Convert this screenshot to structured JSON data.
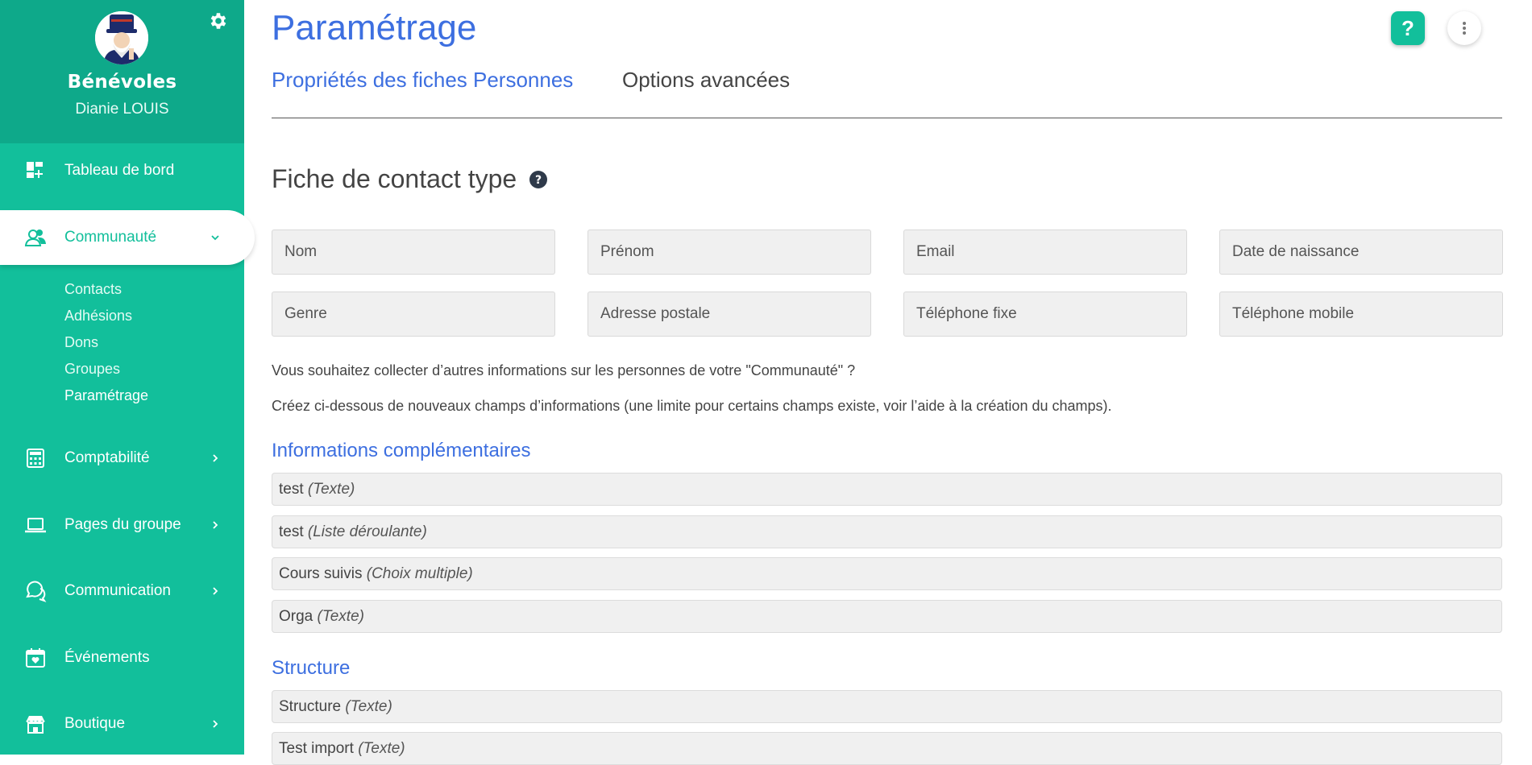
{
  "profile": {
    "name": "Bénévoles",
    "user": "Dianie LOUIS"
  },
  "nav": {
    "dashboard": "Tableau de bord",
    "community": "Communauté",
    "community_sub": [
      "Contacts",
      "Adhésions",
      "Dons",
      "Groupes",
      "Paramétrage"
    ],
    "accounting": "Comptabilité",
    "pages": "Pages du groupe",
    "communication": "Communication",
    "events": "Événements",
    "shop": "Boutique"
  },
  "header": {
    "title": "Paramétrage",
    "help_label": "?"
  },
  "tabs": [
    "Propriétés des fiches Personnes",
    "Options avancées"
  ],
  "contact_card": {
    "title": "Fiche de contact type",
    "fields": [
      "Nom",
      "Prénom",
      "Email",
      "Date de naissance",
      "Genre",
      "Adresse postale",
      "Téléphone fixe",
      "Téléphone mobile"
    ]
  },
  "intro": {
    "line1": "Vous souhaitez collecter d’autres informations sur les personnes de votre \"Communauté\" ?",
    "line2": "Créez ci-dessous de nouveaux champs d’informations (une limite pour certains champs existe, voir l’aide à la création du champs)."
  },
  "groups": [
    {
      "title": "Informations complémentaires",
      "items": [
        {
          "name": "test",
          "type": "(Texte)"
        },
        {
          "name": "test",
          "type": "(Liste déroulante)"
        },
        {
          "name": "Cours suivis",
          "type": "(Choix multiple)"
        },
        {
          "name": "Orga",
          "type": "(Texte)"
        }
      ]
    },
    {
      "title": "Structure",
      "items": [
        {
          "name": "Structure",
          "type": "(Texte)"
        },
        {
          "name": "Test import",
          "type": "(Texte)"
        }
      ]
    }
  ],
  "colors": {
    "sidebar": "#12bf9b",
    "sidebar_header": "#0ea98a",
    "accent": "#3d6fe0"
  }
}
